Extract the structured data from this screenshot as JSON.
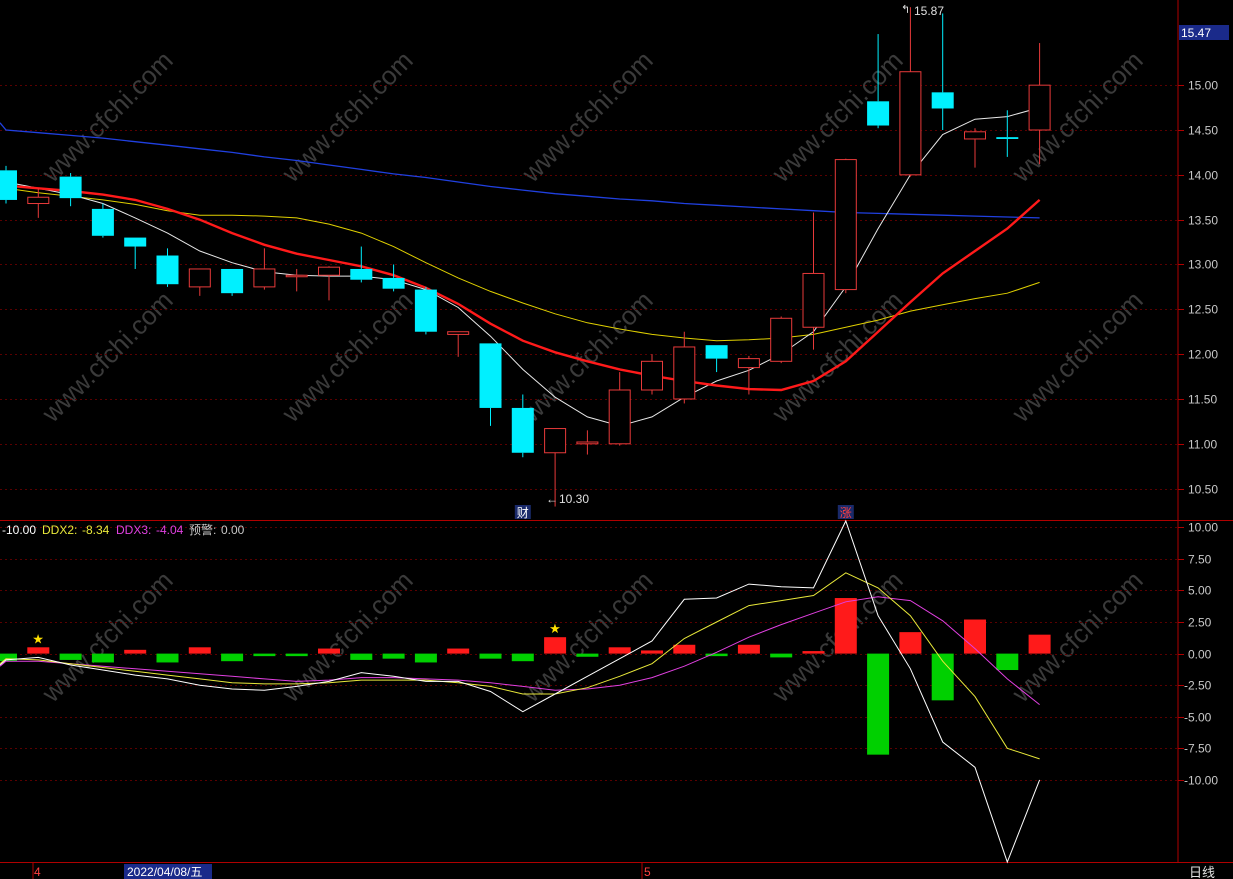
{
  "colors": {
    "background": "#000000",
    "grid": "#5a0000",
    "up": "#e83a3a",
    "down": "#00f0ff",
    "ma_white": "#e8e8e8",
    "ma_yellow": "#e0d000",
    "ma_red": "#ff1a1a",
    "ma_blue": "#2040e0",
    "ddx1": "#ffffff",
    "ddx2": "#e8e83a",
    "ddx3": "#e040e0",
    "bar_red": "#ff1a1a",
    "bar_green": "#00d000",
    "warn": "#c8c8c8"
  },
  "price_panel": {
    "current_price_tag": "15.47",
    "max_label": "15.87",
    "min_label": "10.30",
    "event_markers": [
      {
        "text": "财",
        "index": 16
      },
      {
        "text": "涨",
        "index": 26
      }
    ]
  },
  "indicator_panel": {
    "legend": {
      "ddx1": "-10.00",
      "ddx2_name": "DDX2:",
      "ddx2": "-8.34",
      "ddx3_name": "DDX3:",
      "ddx3": "-4.04",
      "warn_name": "预警:",
      "warn": "0.00"
    }
  },
  "bottom_bar": {
    "tick_a": "4",
    "date_label": "2022/04/08/五",
    "tick_b": "5",
    "period_label": "日线"
  },
  "chart_data": [
    {
      "type": "candlestick",
      "ylim": [
        10.15,
        15.95
      ],
      "yticks": [
        10.5,
        11.0,
        11.5,
        12.0,
        12.5,
        13.0,
        13.5,
        14.0,
        14.5,
        15.0
      ],
      "candles": [
        {
          "o": 14.05,
          "c": 13.72,
          "h": 14.1,
          "l": 13.68
        },
        {
          "o": 13.68,
          "c": 13.75,
          "h": 13.85,
          "l": 13.52
        },
        {
          "o": 13.98,
          "c": 13.74,
          "h": 14.02,
          "l": 13.65
        },
        {
          "o": 13.62,
          "c": 13.32,
          "h": 13.68,
          "l": 13.3
        },
        {
          "o": 13.3,
          "c": 13.2,
          "h": 13.3,
          "l": 12.95
        },
        {
          "o": 13.1,
          "c": 12.78,
          "h": 13.18,
          "l": 12.75
        },
        {
          "o": 12.75,
          "c": 12.95,
          "h": 12.95,
          "l": 12.65
        },
        {
          "o": 12.95,
          "c": 12.68,
          "h": 12.95,
          "l": 12.65
        },
        {
          "o": 12.75,
          "c": 12.95,
          "h": 13.18,
          "l": 12.72
        },
        {
          "o": 12.88,
          "c": 12.88,
          "h": 12.95,
          "l": 12.7
        },
        {
          "o": 12.88,
          "c": 12.97,
          "h": 12.98,
          "l": 12.6
        },
        {
          "o": 12.95,
          "c": 12.83,
          "h": 13.2,
          "l": 12.8
        },
        {
          "o": 12.85,
          "c": 12.73,
          "h": 13.0,
          "l": 12.7
        },
        {
          "o": 12.72,
          "c": 12.25,
          "h": 12.75,
          "l": 12.22
        },
        {
          "o": 12.22,
          "c": 12.25,
          "h": 12.25,
          "l": 11.97
        },
        {
          "o": 12.12,
          "c": 11.4,
          "h": 12.12,
          "l": 11.2
        },
        {
          "o": 11.4,
          "c": 10.9,
          "h": 11.55,
          "l": 10.85
        },
        {
          "o": 10.9,
          "c": 11.17,
          "h": 11.17,
          "l": 10.3
        },
        {
          "o": 11.0,
          "c": 11.02,
          "h": 11.15,
          "l": 10.88
        },
        {
          "o": 11.0,
          "c": 11.6,
          "h": 11.8,
          "l": 10.98
        },
        {
          "o": 11.6,
          "c": 11.92,
          "h": 12.0,
          "l": 11.55
        },
        {
          "o": 11.5,
          "c": 12.08,
          "h": 12.25,
          "l": 11.45
        },
        {
          "o": 12.1,
          "c": 11.95,
          "h": 12.1,
          "l": 11.8
        },
        {
          "o": 11.85,
          "c": 11.95,
          "h": 11.98,
          "l": 11.55
        },
        {
          "o": 11.92,
          "c": 12.4,
          "h": 12.42,
          "l": 11.9
        },
        {
          "o": 12.3,
          "c": 12.9,
          "h": 13.58,
          "l": 12.05
        },
        {
          "o": 12.72,
          "c": 14.17,
          "h": 14.18,
          "l": 12.68
        },
        {
          "o": 14.82,
          "c": 14.55,
          "h": 15.57,
          "l": 14.52
        },
        {
          "o": 14.0,
          "c": 15.15,
          "h": 15.87,
          "l": 13.98
        },
        {
          "o": 14.92,
          "c": 14.74,
          "h": 15.8,
          "l": 14.5
        },
        {
          "o": 14.4,
          "c": 14.48,
          "h": 14.52,
          "l": 14.08
        },
        {
          "o": 14.42,
          "c": 14.4,
          "h": 14.72,
          "l": 14.2
        },
        {
          "o": 14.5,
          "c": 15.0,
          "h": 15.47,
          "l": 14.12
        }
      ],
      "ma_white": [
        13.92,
        13.85,
        13.78,
        13.68,
        13.52,
        13.35,
        13.15,
        13.02,
        12.92,
        12.88,
        12.87,
        12.87,
        12.83,
        12.72,
        12.52,
        12.2,
        11.83,
        11.52,
        11.3,
        11.2,
        11.3,
        11.52,
        11.7,
        11.82,
        12.0,
        12.25,
        12.75,
        13.4,
        14.0,
        14.45,
        14.62,
        14.65,
        14.75
      ],
      "ma_yellow": [
        13.85,
        13.8,
        13.76,
        13.72,
        13.67,
        13.6,
        13.55,
        13.55,
        13.54,
        13.52,
        13.45,
        13.35,
        13.2,
        13.02,
        12.85,
        12.7,
        12.57,
        12.45,
        12.35,
        12.28,
        12.22,
        12.18,
        12.15,
        12.16,
        12.18,
        12.22,
        12.3,
        12.38,
        12.48,
        12.55,
        12.62,
        12.68,
        12.8
      ],
      "ma_red": [
        13.88,
        13.85,
        13.82,
        13.78,
        13.72,
        13.62,
        13.5,
        13.35,
        13.22,
        13.12,
        13.05,
        12.98,
        12.88,
        12.74,
        12.56,
        12.34,
        12.15,
        12.02,
        11.92,
        11.83,
        11.76,
        11.7,
        11.65,
        11.61,
        11.6,
        11.7,
        11.92,
        12.25,
        12.58,
        12.9,
        13.15,
        13.4,
        13.72
      ],
      "ma_blue": [
        14.5,
        14.47,
        14.44,
        14.41,
        14.37,
        14.33,
        14.29,
        14.25,
        14.2,
        14.16,
        14.11,
        14.06,
        14.01,
        13.97,
        13.92,
        13.87,
        13.83,
        13.79,
        13.76,
        13.73,
        13.71,
        13.68,
        13.66,
        13.64,
        13.62,
        13.6,
        13.58,
        13.57,
        13.56,
        13.55,
        13.54,
        13.53,
        13.52
      ]
    },
    {
      "type": "bar+line",
      "ylim": [
        -16.5,
        10.5
      ],
      "yticks": [
        10.0,
        7.5,
        5.0,
        2.5,
        0.0,
        -2.5,
        -5.0,
        -7.5,
        -10.0
      ],
      "bars": [
        -0.6,
        0.5,
        -0.5,
        -0.7,
        0.3,
        -0.7,
        0.5,
        -0.6,
        -0.2,
        -0.2,
        0.4,
        -0.5,
        -0.4,
        -0.7,
        0.4,
        -0.4,
        -0.6,
        1.3,
        -0.25,
        0.5,
        0.25,
        0.7,
        -0.2,
        0.7,
        -0.3,
        0.2,
        4.4,
        -8.0,
        1.7,
        -3.7,
        2.7,
        -1.3,
        1.5
      ],
      "ddx1": [
        -0.5,
        -0.3,
        -0.9,
        -1.3,
        -1.7,
        -2.0,
        -2.5,
        -2.8,
        -2.9,
        -2.6,
        -2.2,
        -1.5,
        -1.8,
        -2.2,
        -2.2,
        -3.0,
        -4.6,
        -3.2,
        -1.8,
        -0.4,
        1.0,
        4.3,
        4.4,
        5.5,
        5.3,
        5.2,
        10.5,
        3.0,
        -1.2,
        -7.0,
        -9.0,
        -16.5,
        -10.0
      ],
      "ddx2": [
        -0.4,
        -0.5,
        -0.8,
        -1.1,
        -1.4,
        -1.7,
        -2.0,
        -2.3,
        -2.4,
        -2.4,
        -2.3,
        -2.1,
        -2.1,
        -2.1,
        -2.3,
        -2.6,
        -3.2,
        -3.2,
        -2.7,
        -1.8,
        -0.8,
        1.2,
        2.5,
        3.8,
        4.2,
        4.6,
        6.4,
        5.2,
        3.0,
        -0.6,
        -3.4,
        -7.5,
        -8.34
      ],
      "ddx3": [
        -0.6,
        -0.6,
        -0.8,
        -1.0,
        -1.2,
        -1.4,
        -1.6,
        -1.8,
        -2.0,
        -2.2,
        -2.1,
        -1.9,
        -1.9,
        -2.0,
        -2.1,
        -2.3,
        -2.6,
        -2.9,
        -2.8,
        -2.5,
        -1.9,
        -1.0,
        0.1,
        1.3,
        2.3,
        3.2,
        4.1,
        4.5,
        4.2,
        2.6,
        0.4,
        -2.0,
        -4.04
      ],
      "star_markers": [
        1,
        17
      ]
    }
  ]
}
